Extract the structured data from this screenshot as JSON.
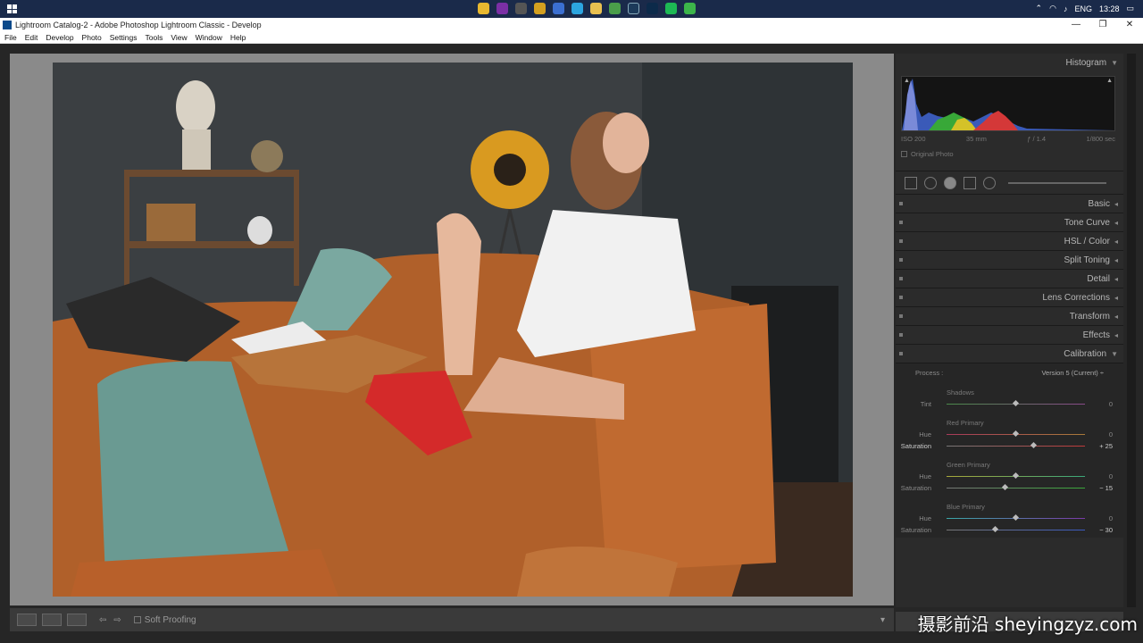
{
  "taskbar": {
    "lang": "ENG",
    "time": "13:28"
  },
  "window": {
    "title": "Lightroom Catalog-2 - Adobe Photoshop Lightroom Classic - Develop",
    "minimize": "—",
    "maximize": "❐",
    "close": "✕"
  },
  "menu": [
    "File",
    "Edit",
    "Develop",
    "Photo",
    "Settings",
    "Tools",
    "View",
    "Window",
    "Help"
  ],
  "histogram": {
    "title": "Histogram",
    "iso": "ISO 200",
    "focal": "35 mm",
    "aperture": "ƒ / 1.4",
    "shutter": "1/800 sec",
    "original_photo": "Original Photo"
  },
  "panels": [
    "Basic",
    "Tone Curve",
    "HSL / Color",
    "Split Toning",
    "Detail",
    "Lens Corrections",
    "Transform",
    "Effects",
    "Calibration"
  ],
  "calibration": {
    "process_label": "Process :",
    "process_value": "Version 5 (Current) ÷",
    "shadows": {
      "title": "Shadows",
      "tint_label": "Tint",
      "tint_value": "0"
    },
    "red": {
      "title": "Red Primary",
      "hue_label": "Hue",
      "hue_value": "0",
      "sat_label": "Saturation",
      "sat_value": "+ 25"
    },
    "green": {
      "title": "Green Primary",
      "hue_label": "Hue",
      "hue_value": "0",
      "sat_label": "Saturation",
      "sat_value": "− 15"
    },
    "blue": {
      "title": "Blue Primary",
      "hue_label": "Hue",
      "hue_value": "0",
      "sat_label": "Saturation",
      "sat_value": "− 30"
    }
  },
  "toolbar": {
    "soft_proofing": "Soft Proofing"
  },
  "watermark": "摄影前沿 sheyingzyz.com"
}
